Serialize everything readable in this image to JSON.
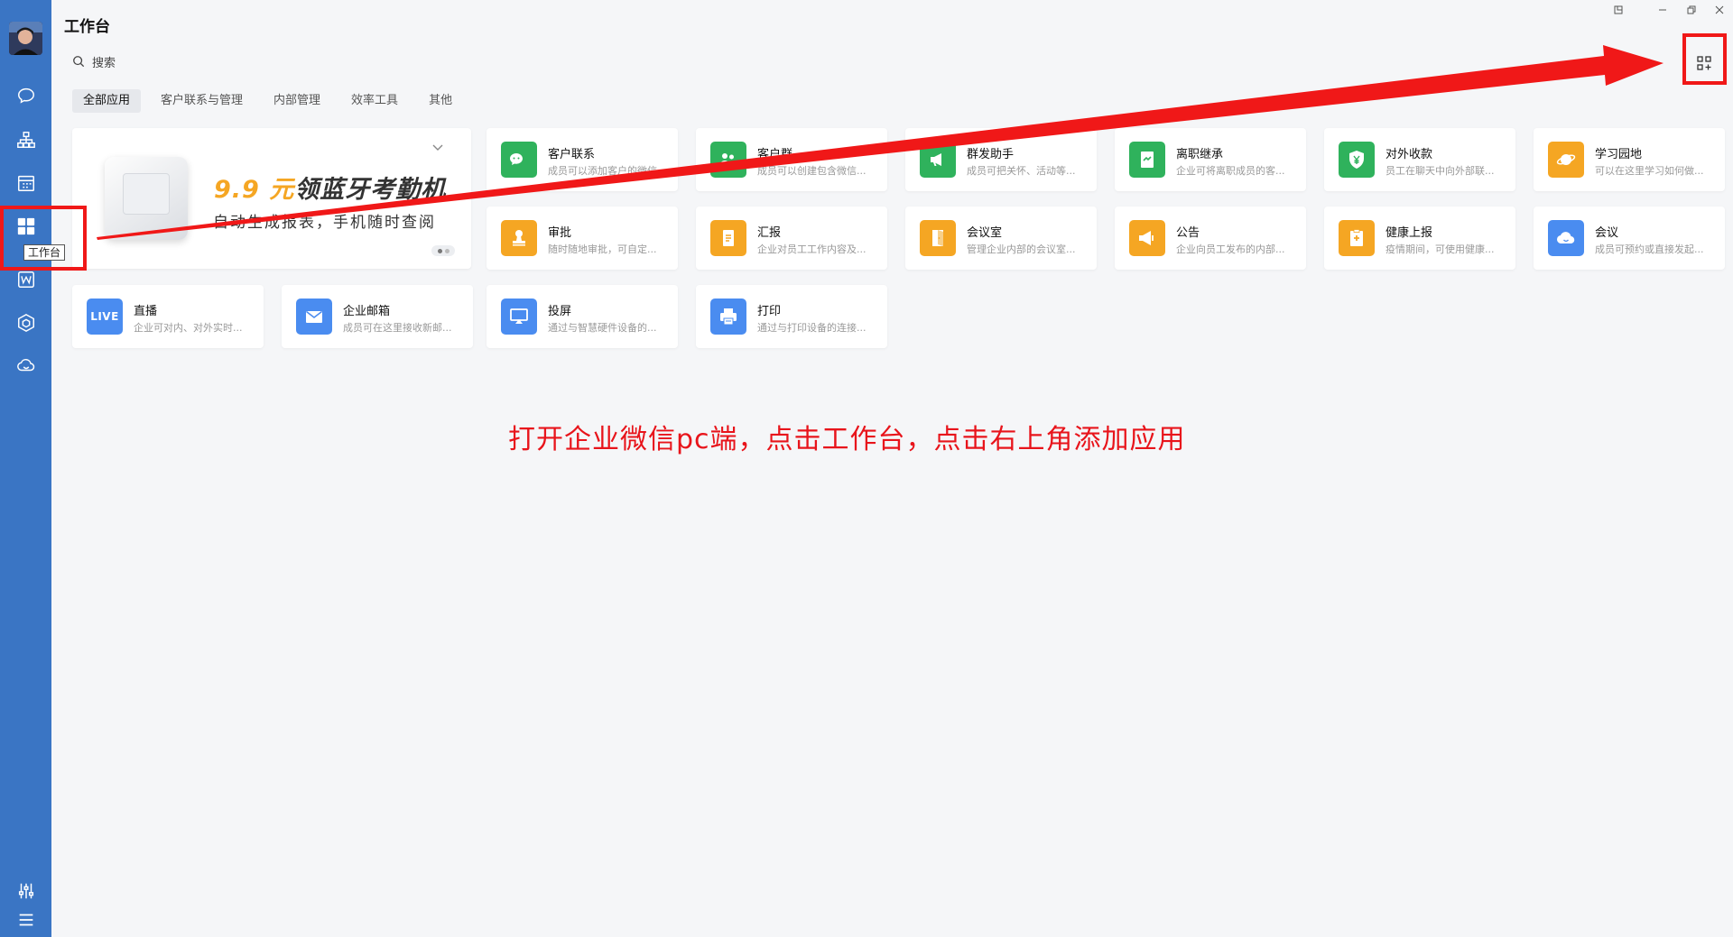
{
  "app": {
    "title": "工作台",
    "search_placeholder": "搜索",
    "tooltip": "工作台"
  },
  "colors": {
    "sidebar": "#3a75c4",
    "green": "#2fb25c",
    "orange": "#f5a623",
    "blue": "#4a8cf0",
    "annotation": "#f01818"
  },
  "sidebar": {
    "items": [
      {
        "name": "chat-bubble-icon"
      },
      {
        "name": "org-chart-icon"
      },
      {
        "name": "calendar-icon"
      },
      {
        "name": "workbench-grid-icon"
      },
      {
        "name": "w-doc-icon"
      },
      {
        "name": "cube-icon"
      },
      {
        "name": "cloud-icon"
      },
      {
        "name": "sliders-icon"
      },
      {
        "name": "menu-icon"
      }
    ]
  },
  "tabs": [
    {
      "label": "全部应用",
      "active": true
    },
    {
      "label": "客户联系与管理",
      "active": false
    },
    {
      "label": "内部管理",
      "active": false
    },
    {
      "label": "效率工具",
      "active": false
    },
    {
      "label": "其他",
      "active": false
    }
  ],
  "banner": {
    "price": "9.9 元",
    "headline": "领蓝牙考勤机",
    "subtitle": "自动生成报表，手机随时查阅"
  },
  "apps": [
    {
      "name": "客户联系",
      "desc": "成员可以添加客户的微信",
      "icon": "wechat-icon",
      "color": "#2fb25c"
    },
    {
      "name": "客户群",
      "desc": "成员可以创建包含微信...",
      "icon": "group-icon",
      "color": "#2fb25c"
    },
    {
      "name": "群发助手",
      "desc": "成员可把关怀、活动等...",
      "icon": "megaphone-icon",
      "color": "#2fb25c"
    },
    {
      "name": "离职继承",
      "desc": "企业可将离职成员的客...",
      "icon": "handover-icon",
      "color": "#2fb25c"
    },
    {
      "name": "对外收款",
      "desc": "员工在聊天中向外部联...",
      "icon": "yuan-shield-icon",
      "color": "#2fb25c"
    },
    {
      "name": "学习园地",
      "desc": "可以在这里学习如何做...",
      "icon": "planet-icon",
      "color": "#f5a623"
    },
    {
      "name": "审批",
      "desc": "随时随地审批，可自定...",
      "icon": "stamp-icon",
      "color": "#f5a623"
    },
    {
      "name": "汇报",
      "desc": "企业对员工工作内容及...",
      "icon": "report-icon",
      "color": "#f5a623"
    },
    {
      "name": "会议室",
      "desc": "管理企业内部的会议室...",
      "icon": "door-icon",
      "color": "#f5a623"
    },
    {
      "name": "公告",
      "desc": "企业向员工发布的内部...",
      "icon": "announce-icon",
      "color": "#f5a623"
    },
    {
      "name": "健康上报",
      "desc": "疫情期间，可使用健康...",
      "icon": "health-clipboard-icon",
      "color": "#f5a623"
    },
    {
      "name": "会议",
      "desc": "成员可预约或直接发起...",
      "icon": "cloud-meeting-icon",
      "color": "#4a8cf0"
    },
    {
      "name": "直播",
      "desc": "企业可对内、对外实时...",
      "icon": "live-icon",
      "live_label": "LIVE",
      "color": "#4a8cf0"
    },
    {
      "name": "企业邮箱",
      "desc": "成员可在这里接收新邮...",
      "icon": "mail-icon",
      "color": "#4a8cf0"
    },
    {
      "name": "投屏",
      "desc": "通过与智慧硬件设备的...",
      "icon": "cast-icon",
      "color": "#4a8cf0"
    },
    {
      "name": "打印",
      "desc": "通过与打印设备的连接...",
      "icon": "printer-icon",
      "color": "#4a8cf0"
    }
  ],
  "annotation": {
    "instruction": "打开企业微信pc端，点击工作台，点击右上角添加应用"
  }
}
